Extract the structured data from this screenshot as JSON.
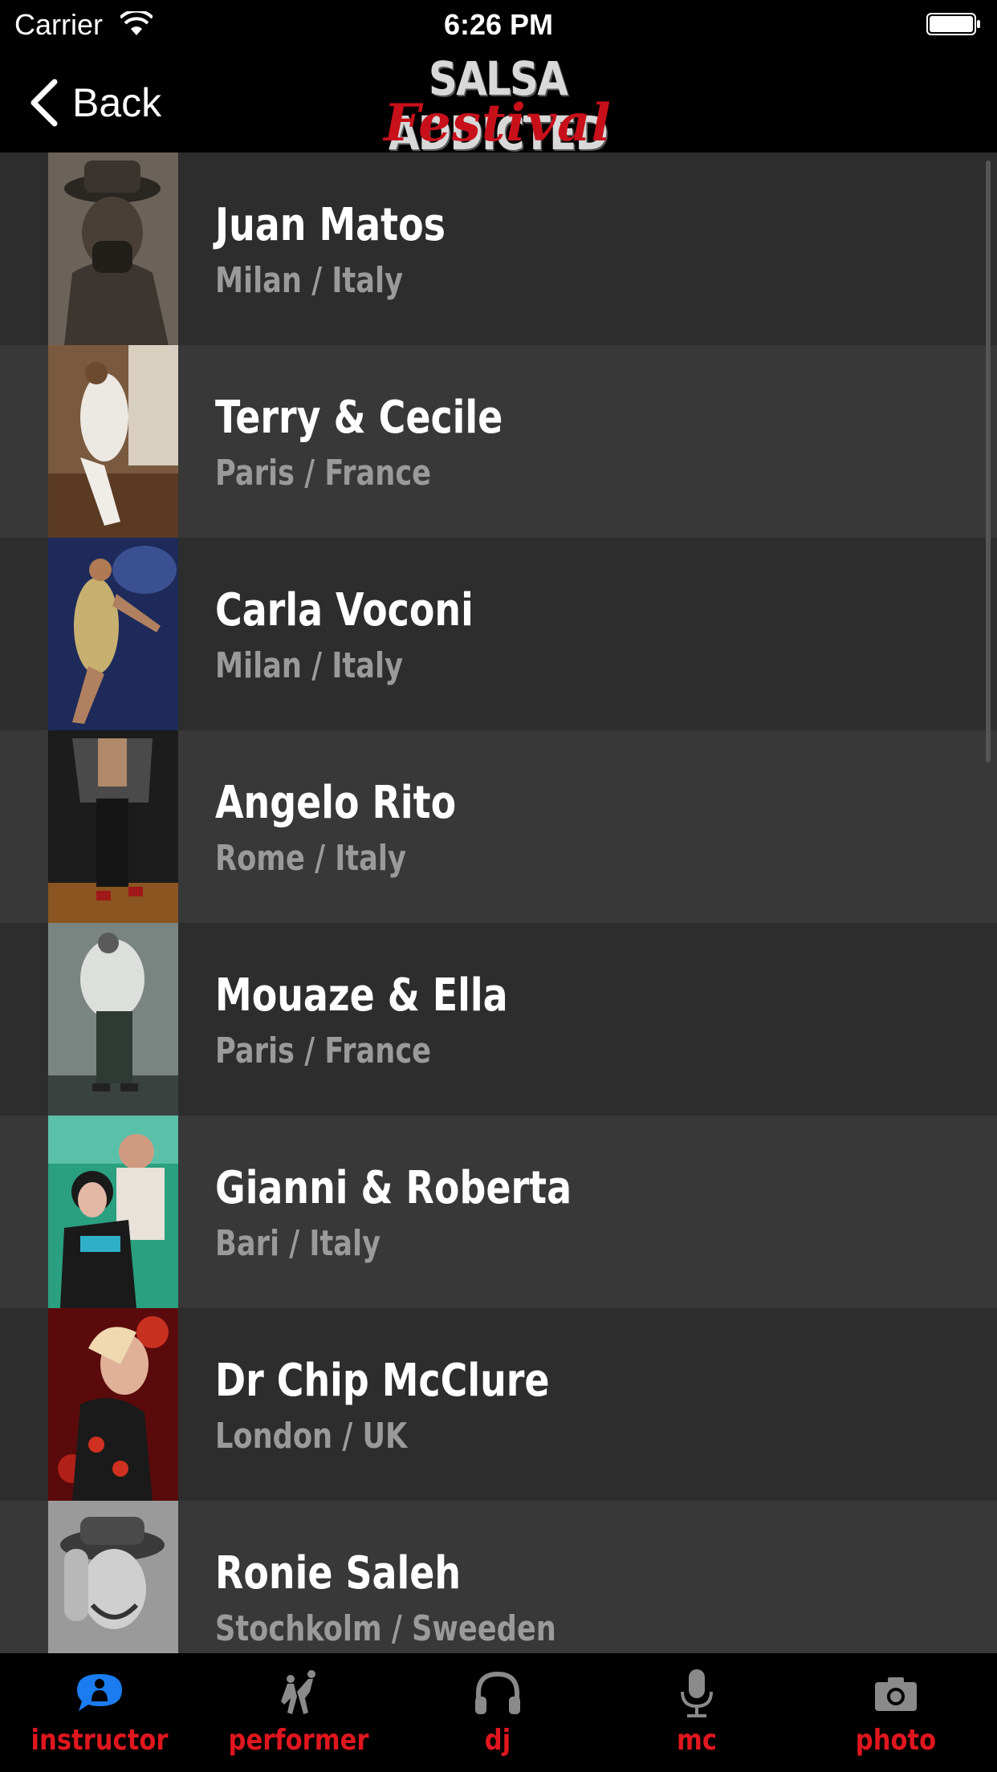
{
  "status_bar": {
    "carrier": "Carrier",
    "time": "6:26 PM"
  },
  "nav": {
    "back_label": "Back",
    "logo_line1": "SALSA ADDICTED",
    "logo_line2": "Festival"
  },
  "artists": [
    {
      "name": "Juan Matos",
      "location": "Milan / Italy"
    },
    {
      "name": "Terry & Cecile",
      "location": "Paris / France"
    },
    {
      "name": "Carla Voconi",
      "location": "Milan / Italy"
    },
    {
      "name": "Angelo Rito",
      "location": "Rome / Italy"
    },
    {
      "name": "Mouaze & Ella",
      "location": "Paris / France"
    },
    {
      "name": "Gianni & Roberta",
      "location": "Bari / Italy"
    },
    {
      "name": "Dr Chip McClure",
      "location": "London / UK"
    },
    {
      "name": "Ronie Saleh",
      "location": "Stochkolm / Sweeden"
    }
  ],
  "tabs": [
    {
      "label": "instructor",
      "icon": "instructor-icon",
      "selected": true
    },
    {
      "label": "performer",
      "icon": "performer-icon",
      "selected": false
    },
    {
      "label": "dj",
      "icon": "headphones-icon",
      "selected": false
    },
    {
      "label": "mc",
      "icon": "microphone-icon",
      "selected": false
    },
    {
      "label": "photo",
      "icon": "camera-icon",
      "selected": false
    }
  ],
  "colors": {
    "accent": "#e0161e",
    "selected_icon": "#1a7cf0",
    "icon_gray": "#8a8a8a",
    "row_dark": "#2d2d2d",
    "row_light": "#383838"
  }
}
